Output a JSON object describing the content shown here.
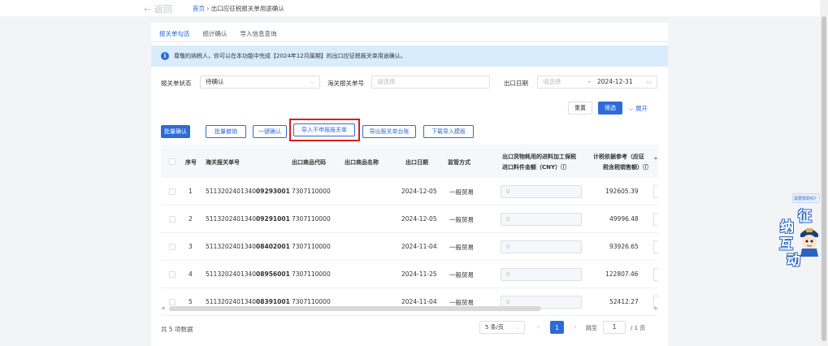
{
  "header": {
    "back_label": "← 返回",
    "breadcrumb_home": "首页",
    "breadcrumb_sep": "›",
    "breadcrumb_current": "出口应征税报关单用途确认"
  },
  "tabs": [
    {
      "label": "报关单勾选",
      "active": true
    },
    {
      "label": "统计确认",
      "active": false
    },
    {
      "label": "导入信息查询",
      "active": false
    }
  ],
  "notice": {
    "icon": "info-icon",
    "text": "尊敬的纳税人，你可以在本功能中完成【2024年12月属期】的出口应征税报关单用途确认。"
  },
  "filters": {
    "status_label": "报关单状态",
    "status_value": "待确认",
    "customs_no_label": "海关报关单号",
    "customs_no_placeholder": "请选择",
    "export_date_label": "出口日期",
    "date_start_placeholder": "请选择",
    "date_sep": "-",
    "date_end": "2024-12-31",
    "reset_label": "重置",
    "filter_label": "筛选",
    "expand_label": "展开"
  },
  "actions": {
    "batch_confirm": "批量确认",
    "batch_revoke": "批量撤销",
    "one_click_confirm": "一键确认",
    "import_no_declare": "导入不申报报关单",
    "export_ledger": "导出报关单台账",
    "download_template": "下载导入模板"
  },
  "table": {
    "headers": {
      "seq": "序号",
      "customs_no": "海关报关单号",
      "product_code": "出口商品代码",
      "product_name": "出口商品名称",
      "export_date": "出口日期",
      "supervision": "监管方式",
      "import_amount_line1": "出口货物耗用的进料加工保税",
      "import_amount_line2": "进口料件金额（CNY）ⓘ",
      "tax_basis_line1": "计税依据参考（应征",
      "tax_basis_line2": "税含税销售额）ⓘ",
      "required_mark": "*"
    },
    "rows": [
      {
        "seq": "1",
        "no_prefix": "5113202401340",
        "no_bold": "09293001",
        "code": "7307110000",
        "name": "",
        "date": "2024-12-05",
        "method": "一般贸易",
        "amount_placeholder": "0",
        "basis": "192605.39"
      },
      {
        "seq": "2",
        "no_prefix": "5113202401340",
        "no_bold": "09291001",
        "code": "7307110000",
        "name": "",
        "date": "2024-12-05",
        "method": "一般贸易",
        "amount_placeholder": "0",
        "basis": "49996.48"
      },
      {
        "seq": "3",
        "no_prefix": "5113202401340",
        "no_bold": "08402001",
        "code": "7307110000",
        "name": "",
        "date": "2024-11-04",
        "method": "一般贸易",
        "amount_placeholder": "0",
        "basis": "93926.65"
      },
      {
        "seq": "4",
        "no_prefix": "5113202401340",
        "no_bold": "08956001",
        "code": "7307110000",
        "name": "",
        "date": "2024-11-25",
        "method": "一般贸易",
        "amount_placeholder": "0",
        "basis": "122807.46"
      },
      {
        "seq": "5",
        "no_prefix": "5113202401340",
        "no_bold": "08391001",
        "code": "7307110000",
        "name": "",
        "date": "2024-11-04",
        "method": "一般贸易",
        "amount_placeholder": "0",
        "basis": "52412.27"
      }
    ]
  },
  "pagination": {
    "total": "共 5 项数据",
    "page_size": "5 条/页",
    "prev": "‹",
    "current": "1",
    "next": "›",
    "jump_label": "跳至",
    "jump_value": "1",
    "page_suffix": "/ 1 页"
  },
  "side_widget": {
    "help_label": "需要帮助吗？",
    "mascot_chars": [
      "征",
      "纳",
      "互",
      "动"
    ]
  },
  "colors": {
    "primary": "#2e6bd8",
    "highlight": "#d81e1e",
    "notice_bg": "#d9ecfc"
  }
}
